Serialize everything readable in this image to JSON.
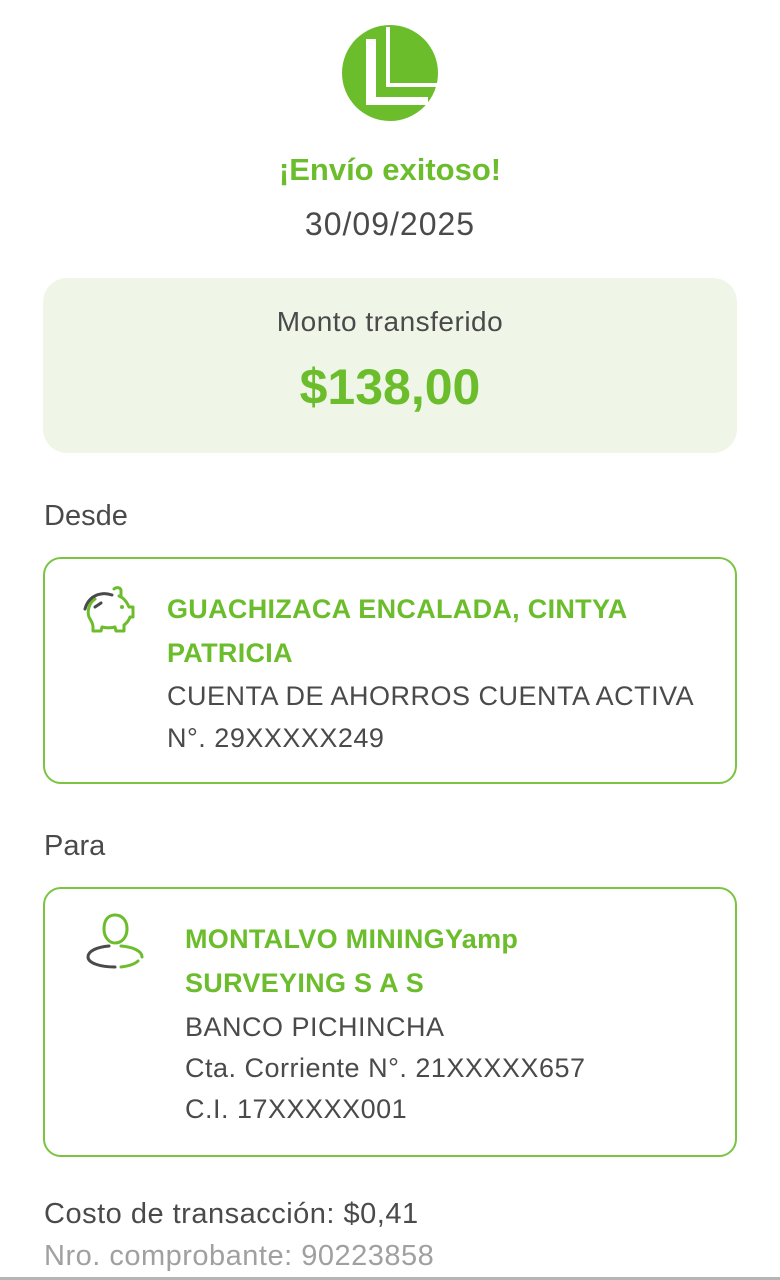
{
  "header": {
    "logo_icon": "bank-logo-icon",
    "success_title": "¡Envío exitoso!",
    "date": "30/09/2025"
  },
  "amount": {
    "label": "Monto transferido",
    "value": "$138,00"
  },
  "from": {
    "section_label": "Desde",
    "icon": "piggy-bank-icon",
    "name_line1": "GUACHIZACA ENCALADA, CINTYA",
    "name_line2": "PATRICIA",
    "account_type": "CUENTA DE AHORROS CUENTA ACTIVA",
    "account_number": "N°. 29XXXXX249"
  },
  "to": {
    "section_label": "Para",
    "icon": "user-icon",
    "name_line1": "MONTALVO MININGYamp",
    "name_line2": "SURVEYING S A S",
    "bank": "BANCO PICHINCHA",
    "account": "Cta. Corriente N°. 21XXXXX657",
    "id": "C.I. 17XXXXX001"
  },
  "footer": {
    "fee": "Costo de transacción: $0,41",
    "receipt": "Nro. comprobante: 90223858"
  },
  "colors": {
    "accent": "#6cbd2c",
    "card_bg": "#eff6e8",
    "border": "#7bc442",
    "text": "#4a4a4a",
    "muted": "#a0a0a0"
  }
}
